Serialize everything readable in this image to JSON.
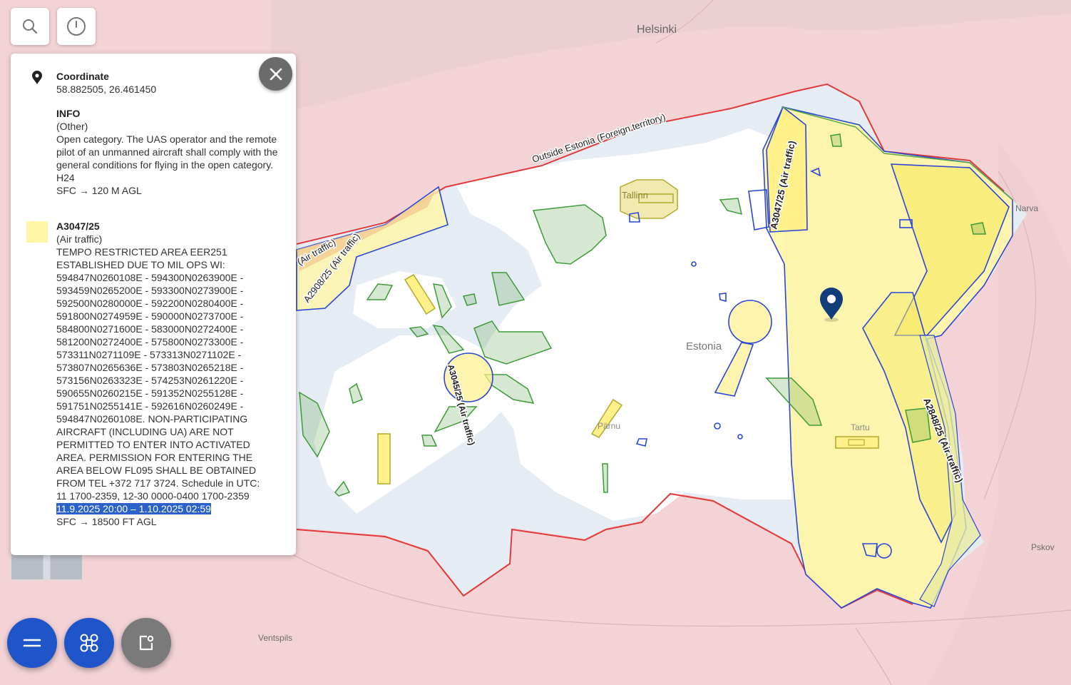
{
  "map": {
    "city_labels": {
      "helsinki": "Helsinki",
      "narva": "Narva",
      "tallinn": "Tallinn",
      "parnu": "Pärnu",
      "tartu": "Tartu",
      "pskov": "Pskov",
      "ventspils": "Ventspils"
    },
    "country_label": "Estonia",
    "border_label": "Outside Estonia (Foreign territory)",
    "zone_labels": {
      "a3047_vertical": "A3047/25 (Air traffic)",
      "a2908": "A2908/25 (Air traffic)",
      "air_traffic_left": "(Air traffic)",
      "a3045": "A3045/25 (Air traffic)",
      "a2848": "A2848/25 (Air traffic)"
    },
    "colors": {
      "foreign_territory": "#f3d3d6",
      "estonia_land": "#ffffff",
      "airspace_fill": "#e6ecf4",
      "border": "#e03a3a",
      "restricted_yellow": "#fff6a6",
      "zone_green": "#5aa54a",
      "zone_blue": "#2a45d8",
      "marker": "#123c7a"
    }
  },
  "toolbar": {
    "search_icon": "search-icon",
    "clock_icon": "clock-icon"
  },
  "info_panel": {
    "coordinate": {
      "title": "Coordinate",
      "value": "58.882505, 26.461450",
      "icon": "location-pin-icon"
    },
    "info": {
      "title": "INFO",
      "category": "(Other)",
      "description": "Open category. The UAS operator and the remote pilot of an unmanned aircraft shall comply with the general conditions for flying in the open category.",
      "schedule": "H24",
      "altitude": "SFC → 120 M AGL"
    },
    "notam": {
      "title": "A3047/25",
      "category": "(Air traffic)",
      "description": "TEMPO RESTRICTED AREA EER251 ESTABLISHED DUE TO MIL OPS WI: 594847N0260108E - 594300N0263900E - 593459N0265200E - 593300N0273900E - 592500N0280000E - 592200N0280400E - 591800N0274959E - 590000N0273700E - 584800N0271600E - 583000N0272400E - 581200N0272400E - 575800N0273300E - 573311N0271109E - 573313N0271102E - 573807N0265636E - 573803N0265218E - 573156N0263323E - 574253N0261220E - 590655N0260215E - 591352N0255128E - 591751N0255141E - 592616N0260249E - 594847N0260108E. NON-PARTICIPATING AIRCRAFT (INCLUDING UA) ARE NOT PERMITTED TO ENTER INTO ACTIVATED AREA. PERMISSION FOR ENTERING THE AREA BELOW FL095 SHALL BE OBTAINED FROM TEL +372 717 3724. Schedule in UTC: 11 1700-2359, 12-30 0000-0400 1700-2359",
      "validity": "11.9.2025 20:00 – 1.10.2025 02:59",
      "altitude": "SFC → 18500 FT AGL",
      "swatch_color": "#fff6a6"
    },
    "close_icon": "close-icon"
  },
  "fabs": {
    "menu_icon": "menu-icon",
    "drone_icon": "drone-icon",
    "export_icon": "export-icon",
    "menu_color": "#1f55c9",
    "drone_color": "#1f55c9",
    "export_color": "#7a7a7a"
  }
}
